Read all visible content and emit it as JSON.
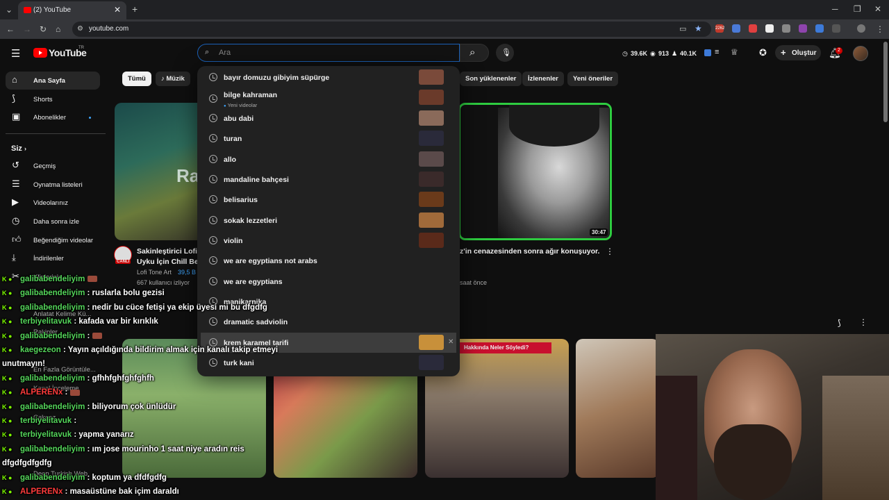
{
  "browser": {
    "tab_title": "(2) YouTube",
    "url": "youtube.com",
    "ext_badge": "2262"
  },
  "header": {
    "logo_text": "YouTube",
    "logo_region": "TR",
    "search_placeholder": "Ara",
    "stats": [
      "39.6K",
      "913",
      "40.1K"
    ],
    "create_label": "Oluştur",
    "notif_count": "2"
  },
  "sidebar": {
    "top": [
      "Ana Sayfa",
      "Shorts",
      "Abonelikler"
    ],
    "section_title": "Siz",
    "you": [
      "Geçmiş",
      "Oynatma listeleri",
      "Videolarınız",
      "Daha sonra izle",
      "Beğendiğim videolar",
      "İndirilenler",
      "Klipleriniz"
    ],
    "ghost": [
      "Anlatat Kelime Kü...",
      "Rakipler",
      "En Fazla Görüntüle...",
      "Kanal İnceleme",
      "Çakgez",
      "Deep Turkish Web"
    ]
  },
  "chips": [
    "Tümü",
    "Müzik",
    "Son yüklenenler",
    "İzlenenler",
    "Yeni öneriler"
  ],
  "videos": {
    "v1_title_line1": "Sakinleştirici Lofi",
    "v1_title_line2": "Uyku İçin Chill Bea",
    "v1_channel": "Lofi Tone Art",
    "v1_count": "39,5 B",
    "v1_meta": "667 kullanıcı izliyor",
    "v1_live": "CANLI",
    "v1_thumb_text": "Ra",
    "v2_title": "z'in cenazesinden sonra ağır konuşuyor.",
    "v2_meta": "saat önce",
    "v2_duration": "30:47",
    "short3_label": "Hakkında Neler Söyledi?"
  },
  "suggestions": [
    {
      "text": "bayır domuzu gibiyim süpürge",
      "thumb": "#7a4a3a"
    },
    {
      "text": "bilge kahraman",
      "sub": "Yeni videolar",
      "thumb": "#6a3a2a"
    },
    {
      "text": "abu dabi",
      "thumb": "#8a6a5a"
    },
    {
      "text": "turan",
      "thumb": "#2a2a3a"
    },
    {
      "text": "allo",
      "thumb": "#5a4a4a"
    },
    {
      "text": "mandaline bahçesi",
      "thumb": "#3a2a2a"
    },
    {
      "text": "belisarius",
      "thumb": "#6a3a1a"
    },
    {
      "text": "sokak lezzetleri",
      "thumb": "#a06a3a"
    },
    {
      "text": "violin",
      "thumb": "#5a2a1a"
    },
    {
      "text": "we are egyptians not arabs"
    },
    {
      "text": "we are egyptians"
    },
    {
      "text": "manikarnika"
    },
    {
      "text": "dramatic sadviolin"
    },
    {
      "text": "krem karamel tarifi",
      "thumb": "#c8903a",
      "hover": true
    },
    {
      "text": "turk kani",
      "thumb": "#2a2a3a"
    }
  ],
  "chat": [
    {
      "name": "galibabendeliyim",
      "text": "",
      "emote": true
    },
    {
      "name": "galibabendeliyim",
      "text": ": ruslarla bolu gezisi"
    },
    {
      "name": "galibabendeliyim",
      "text": ": nedir bu cüce fetişi ya ekip üyesi mi bu dfgdfg"
    },
    {
      "name": "terbiyelitavuk",
      "text": ": kafada var bir kırıklık"
    },
    {
      "name": "galibabendeliyim",
      "text": ":",
      "emote": true
    },
    {
      "name": "kaegezeon",
      "text": ": Yayın açıldığında bildirim almak için kanalı takip etmeyi"
    },
    {
      "name": "",
      "text": "unutmayın!"
    },
    {
      "name": "galibabendeliyim",
      "text": ": gfhhfghfghfghfh"
    },
    {
      "name": "ALPERENx",
      "text": ":",
      "red": true,
      "emote": true
    },
    {
      "name": "galibabendeliyim",
      "text": ": biliyorum çok ünlüdür"
    },
    {
      "name": "terbiyelitavuk",
      "text": ":"
    },
    {
      "name": "terbiyelitavuk",
      "text": ": yapma yanarız"
    },
    {
      "name": "galibabendeliyim",
      "text": ": ım jose mourinho 1 saat niye aradın reis"
    },
    {
      "name": "",
      "text": "dfgdfgdfgdfg"
    },
    {
      "name": "galibabendeliyim",
      "text": ": koptum ya dfdfgdfg"
    },
    {
      "name": "ALPERENx",
      "text": ": masaüstüne bak içim daraldı",
      "red": true
    }
  ]
}
